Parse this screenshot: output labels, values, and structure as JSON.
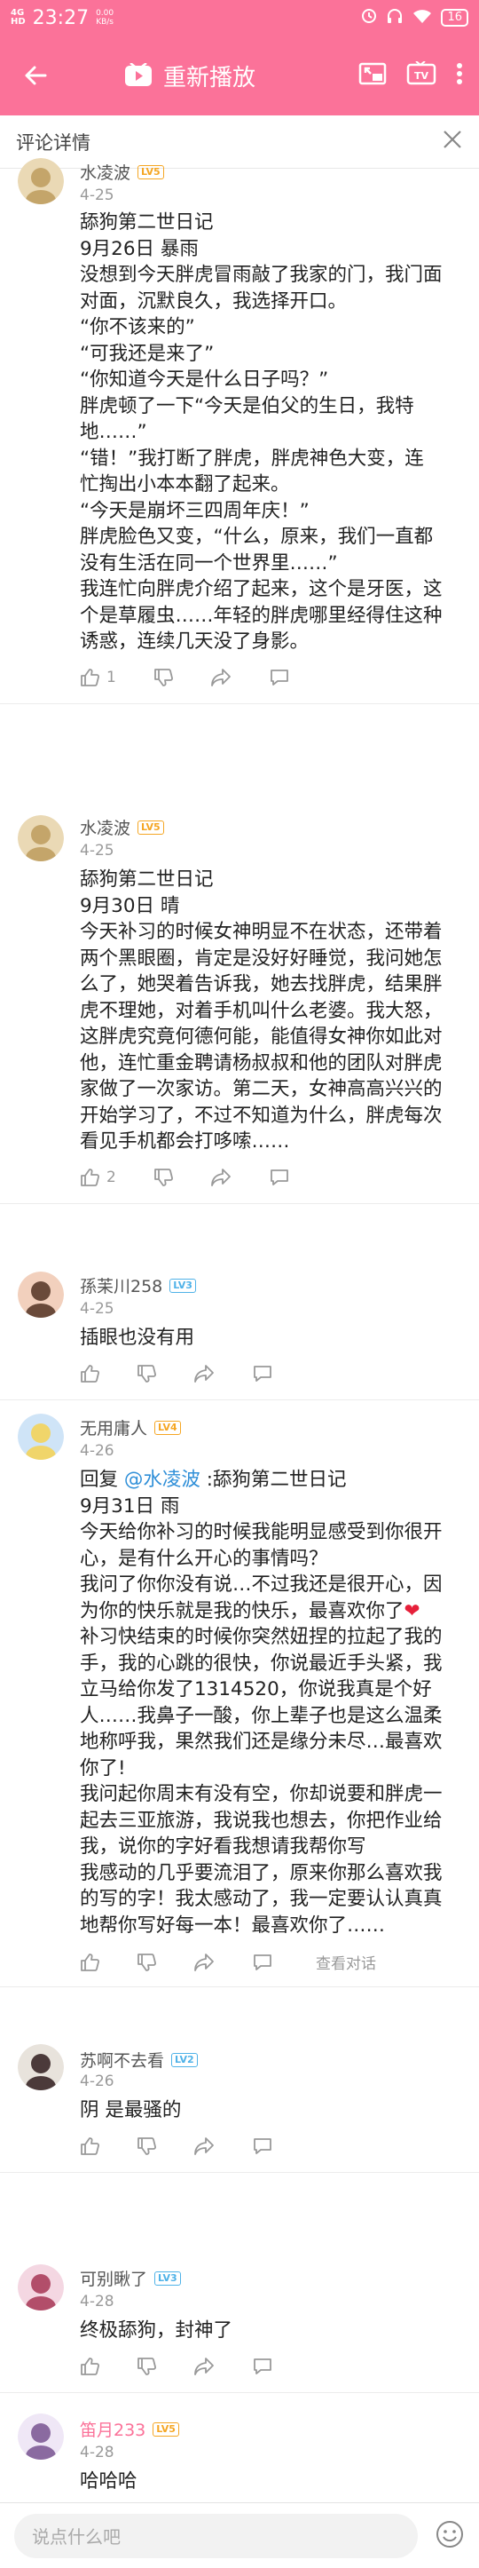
{
  "status_bar": {
    "signal_top": "4G",
    "signal_bottom": "HD",
    "time": "23:27",
    "speed_value": "0.00",
    "speed_unit": "KB/s",
    "battery": "16"
  },
  "top_bar": {
    "replay_label": "重新播放"
  },
  "header": {
    "title": "评论详情"
  },
  "comments": [
    {
      "username": "水凌波",
      "level": "LV5",
      "level_color": "#f5a623",
      "name_color": "#555555",
      "date": "4-25",
      "lines": [
        "舔狗第二世日记",
        "9月26日 暴雨",
        "没想到今天胖虎冒雨敲了我家的门，我门面",
        "对面，沉默良久，我选择开口。",
        "“你不该来的”",
        "“可我还是来了”",
        "“你知道今天是什么日子吗？”",
        "胖虎顿了一下“今天是伯父的生日，我特",
        "地……”",
        "“错！”我打断了胖虎，胖虎神色大变，连",
        "忙掏出小本本翻了起来。",
        "“今天是崩坏三四周年庆！”",
        "胖虎脸色又变，“什么，原来，我们一直都",
        "没有生活在同一个世界里……”",
        "我连忙向胖虎介绍了起来，这个是牙医，这",
        "个是草履虫……年轻的胖虎哪里经得住这种",
        "诱惑，连续几天没了身影。"
      ],
      "likes": "1"
    },
    {
      "username": "水凌波",
      "level": "LV5",
      "level_color": "#f5a623",
      "name_color": "#555555",
      "date": "4-25",
      "lines": [
        "舔狗第二世日记",
        "9月30日 晴",
        "今天补习的时候女神明显不在状态，还带着",
        "两个黑眼圈，肯定是没好好睡觉，我问她怎",
        "么了，她哭着告诉我，她去找胖虎，结果胖",
        "虎不理她，对着手机叫什么老婆。我大怒，",
        "这胖虎究竟何德何能，能值得女神你如此对",
        "他，连忙重金聘请杨叔叔和他的团队对胖虎",
        "家做了一次家访。第二天，女神高高兴兴的",
        "开始学习了，不过不知道为什么，胖虎每次",
        "看见手机都会打哆嗦……"
      ],
      "likes": "2"
    },
    {
      "username": "孫苿川258",
      "level": "LV3",
      "level_color": "#4fb2e8",
      "name_color": "#555555",
      "date": "4-25",
      "lines": [
        "插眼也没有用"
      ],
      "likes": ""
    },
    {
      "username": "无用庸人",
      "level": "LV4",
      "level_color": "#f5a623",
      "name_color": "#555555",
      "date": "4-26",
      "reply_prefix": "回复 ",
      "reply_mention": "@水凌波",
      "reply_suffix": " :舔狗第二世日记",
      "lines": [
        "9月31日 雨",
        "今天给你补习的时候我能明显感受到你很开",
        "心，是有什么开心的事情吗？",
        "我问了你你没有说…不过我还是很开心，因",
        "为你的快乐就是我的快乐，最喜欢你了",
        "补习快结束的时候你突然妞捏的拉起了我的",
        "手，我的心跳的很快，你说最近手头紧，我",
        "立马给你发了1314520，你说我真是个好",
        "人……我鼻子一酸，你上辈子也是这么温柔",
        "地称呼我，果然我们还是缘分未尽…最喜欢",
        "你了!",
        "我问起你周末有没有空，你却说要和胖虎一",
        "起去三亚旅游，我说我也想去，你把作业给",
        "我，说你的字好看我想请我帮你写",
        "我感动的几乎要流泪了，原来你那么喜欢我",
        "的写的字！我太感动了，我一定要认认真真",
        "地帮你写好每一本！最喜欢你了……"
      ],
      "heart_symbol": "❤",
      "view_conversation": "查看对话",
      "likes": ""
    },
    {
      "username": "苏啊不去看",
      "level": "LV2",
      "level_color": "#4fb2e8",
      "name_color": "#555555",
      "date": "4-26",
      "lines": [
        "阴 是最骚的"
      ],
      "likes": ""
    },
    {
      "username": "可别瞅了",
      "level": "LV3",
      "level_color": "#4fb2e8",
      "name_color": "#555555",
      "date": "4-28",
      "lines": [
        "终极舔狗，封神了"
      ],
      "likes": ""
    },
    {
      "username": "笛月233",
      "level": "LV5",
      "level_color": "#f5a623",
      "name_color": "#fb7299",
      "date": "4-28",
      "lines": [
        "哈哈哈"
      ],
      "likes": ""
    }
  ],
  "input_bar": {
    "placeholder": "说点什么吧"
  },
  "colors": {
    "brand_pink": "#fb7299",
    "mention_blue": "#2f8fd8",
    "heart_red": "#e6203a"
  },
  "icons": [
    "back-arrow-icon",
    "play-icon",
    "pip-icon",
    "tv-cast-icon",
    "more-vertical-icon",
    "close-icon",
    "like-icon",
    "dislike-icon",
    "share-icon",
    "comment-icon",
    "emoji-icon"
  ]
}
